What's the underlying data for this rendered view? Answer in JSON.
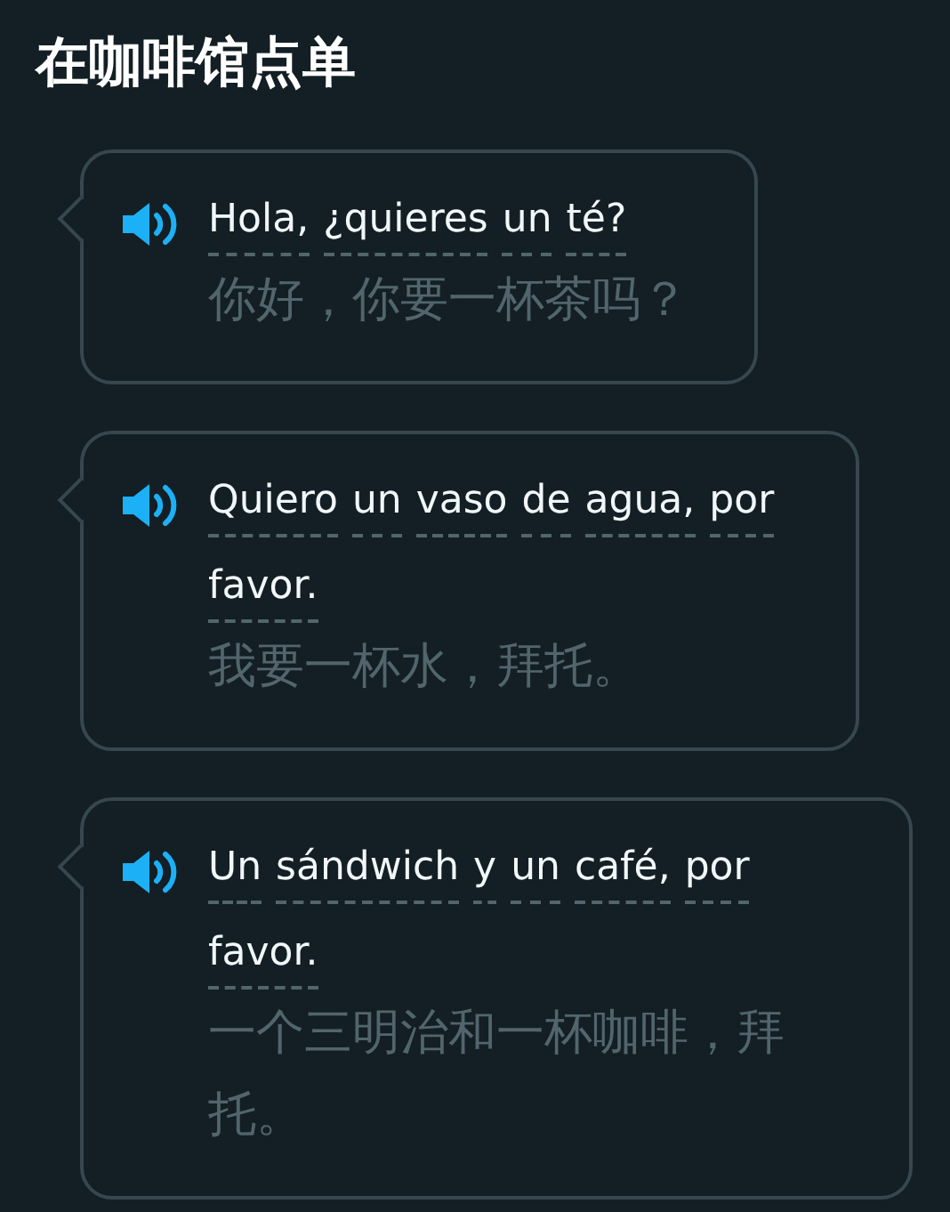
{
  "title": "在咖啡馆点单",
  "messages": [
    {
      "words": [
        "Hola,",
        "¿quieres",
        "un",
        "té?"
      ],
      "translation": "你好，你要一杯茶吗？"
    },
    {
      "words": [
        "Quiero",
        "un",
        "vaso",
        "de",
        "agua,",
        "por",
        "favor."
      ],
      "translation": "我要一杯水，拜托。"
    },
    {
      "words": [
        "Un",
        "sándwich",
        "y",
        "un",
        "café,",
        "por",
        "favor."
      ],
      "translation": "一个三明治和一杯咖啡，拜托。"
    }
  ]
}
